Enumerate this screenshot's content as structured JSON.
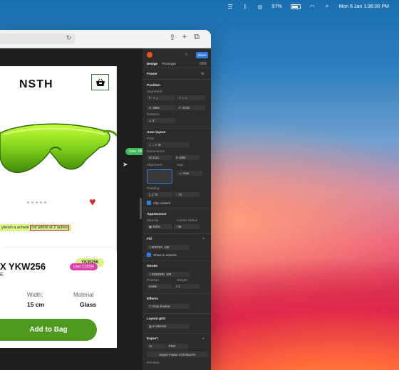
{
  "menubar": {
    "battery_percent": "97%",
    "datetime": "Mon 6 Jan 1:36:00 PM"
  },
  "product_card": {
    "logo": "NSTH",
    "comment_prefix": "ylerish a acheté ",
    "comment_highlight": "cet article et 2 autres",
    "user_tag_1": "User 184653",
    "user_tag_2": "User 213584",
    "product_name": "X YKW256",
    "badge": "YKW256",
    "small_text": "E",
    "width_label": "Width:",
    "width_value": "15 cm",
    "material_label": "Material",
    "material_value": "Glass",
    "add_to_bag": "Add to Bag"
  },
  "panel": {
    "tabs": [
      "Design",
      "Prototype"
    ],
    "zoom": "56%",
    "share": "Share",
    "frame_label": "Frame",
    "position": "Position",
    "alignment": "Alignment",
    "pos_x": "-3804",
    "pos_y": "-4739",
    "rotation": "Rotation",
    "rotation_value": "0°",
    "auto_layout": "Auto layout",
    "flow": "Flow",
    "dimensions": "Dimensions",
    "width": "2112",
    "height": "1000",
    "alignment2": "Alignment",
    "gap": "Gap",
    "gap_value": "Auto",
    "padding": "Padding",
    "pad_h": "72",
    "pad_v": "72",
    "clip": "Clip content",
    "appearance": "Appearance",
    "opacity_label": "Opacity",
    "corner_label": "Corner radius",
    "opacity": "100%",
    "corner": "28",
    "fill": "Fill",
    "fill_hex": "FFFFFF",
    "fill_opacity": "100",
    "show_exports": "Show in exports",
    "stroke": "Stroke",
    "stroke_hex": "DDDDDD",
    "stroke_opacity": "100",
    "stroke_position_label": "Position",
    "stroke_weight_label": "Weight",
    "stroke_position": "Inside",
    "stroke_weight": "1",
    "effects": "Effects",
    "drop_shadow": "Drop shadow",
    "layout_grid": "Layout grid",
    "grid_value": "6 columns",
    "export": "Export",
    "export_scale": "1x",
    "export_format": "PNG",
    "export_button": "Export Frame 1737461374",
    "preview": "Preview"
  },
  "colors": {
    "accent_green": "#4e9a1e",
    "badge_green": "#d9f58a",
    "figma_blue": "#2f7de1",
    "user_tag_1": "#3dbb5a",
    "user_tag_2": "#e040a8"
  }
}
